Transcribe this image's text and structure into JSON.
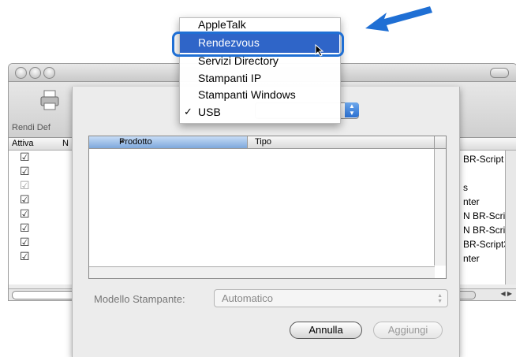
{
  "window": {
    "toolbar_label": "Rendi Def",
    "headers": {
      "attiva": "Attiva",
      "n": "N"
    },
    "right_column": [
      "BR-Script",
      "s",
      "nter",
      "N BR-Scri",
      "N BR-Scri",
      "BR-Script3",
      "nter"
    ]
  },
  "sheet": {
    "table": {
      "col_prodotto": "Prodotto",
      "col_tipo": "Tipo"
    },
    "model_label": "Modello Stampante:",
    "model_value": "Automatico",
    "cancel_label": "Annulla",
    "add_label": "Aggiungi"
  },
  "menu": {
    "items": [
      {
        "label": "AppleTalk"
      },
      {
        "label": "Rendezvous",
        "highlighted": true
      },
      {
        "label": "Servizi Directory"
      },
      {
        "label": "Stampanti IP"
      },
      {
        "label": "Stampanti Windows"
      },
      {
        "label": "USB",
        "checked": true
      }
    ],
    "check_mark": "✓"
  },
  "colors": {
    "highlight": "#2f65c8",
    "annotation": "#1f6fd4"
  }
}
